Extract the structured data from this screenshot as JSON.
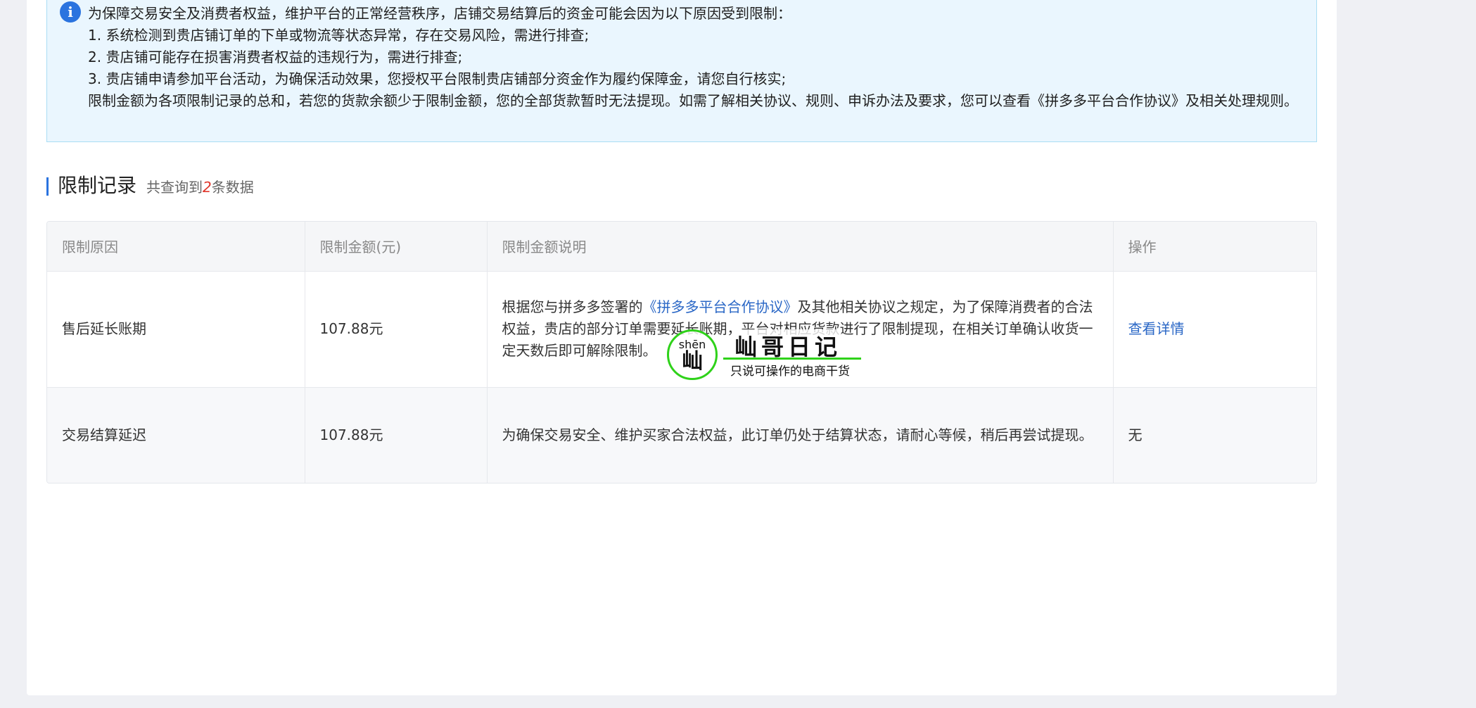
{
  "notice": {
    "icon": "info-icon",
    "lines": [
      "为保障交易安全及消费者权益，维护平台的正常经营秩序，店铺交易结算后的资金可能会因为以下原因受到限制：",
      "1. 系统检测到贵店铺订单的下单或物流等状态异常，存在交易风险，需进行排查;",
      "2. 贵店铺可能存在损害消费者权益的违规行为，需进行排查;",
      "3. 贵店铺申请参加平台活动，为确保活动效果，您授权平台限制贵店铺部分资金作为履约保障金，请您自行核实;",
      "限制金额为各项限制记录的总和，若您的货款余额少于限制金额，您的全部货款暂时无法提现。如需了解相关协议、规则、申诉办法及要求，您可以查看《拼多多平台合作协议》及相关处理规则。"
    ]
  },
  "section": {
    "title": "限制记录",
    "count_prefix": "共查询到",
    "count": "2",
    "count_suffix": "条数据"
  },
  "table": {
    "headers": [
      "限制原因",
      "限制金额(元)",
      "限制金额说明",
      "操作"
    ],
    "rows": [
      {
        "reason": "售后延长账期",
        "amount": "107.88元",
        "desc_before": "根据您与拼多多签署的",
        "desc_link": "《拼多多平台合作协议》",
        "desc_after": "及其他相关协议之规定，为了保障消费者的合法权益，贵店的部分订单需要延长账期，平台对相应货款进行了限制提现，在相关订单确认收货一定天数后即可解除限制。",
        "action": "查看详情"
      },
      {
        "reason": "交易结算延迟",
        "amount": "107.88元",
        "desc_before": "为确保交易安全、维护买家合法权益，此订单仍处于结算状态，请耐心等候，稍后再尝试提现。",
        "desc_link": "",
        "desc_after": "",
        "action": "无"
      }
    ]
  },
  "watermark": {
    "pinyin": "shēn",
    "char": "屾",
    "title": "屾哥日记",
    "subtitle": "只说可操作的电商干货"
  },
  "colors": {
    "accent": "#2a73df",
    "link": "#2a67c6",
    "count_highlight": "#e0372c",
    "notice_bg": "#eaf6fe",
    "watermark_green": "#2fd21a"
  }
}
